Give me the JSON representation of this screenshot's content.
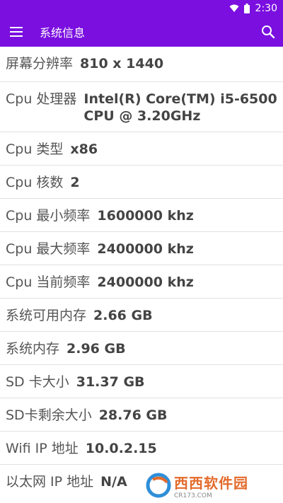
{
  "status_bar": {
    "time": "2:30",
    "icons": [
      "wifi-icon",
      "battery-icon"
    ]
  },
  "app_bar": {
    "title": "系统信息",
    "menu_icon": "menu-icon",
    "search_icon": "search-icon"
  },
  "colors": {
    "accent": "#7A0FE0",
    "divider": "#e1e1e1",
    "text": "#444444"
  },
  "rows": [
    {
      "label": "屏幕分辨率",
      "value": "810 x 1440"
    },
    {
      "label": "Cpu 处理器",
      "value": "Intel(R) Core(TM) i5-6500 CPU @ 3.20GHz"
    },
    {
      "label": "Cpu 类型",
      "value": "x86"
    },
    {
      "label": "Cpu 核数",
      "value": "2"
    },
    {
      "label": "Cpu 最小频率",
      "value": "1600000 khz"
    },
    {
      "label": "Cpu 最大频率",
      "value": "2400000 khz"
    },
    {
      "label": "Cpu 当前频率",
      "value": "2400000 khz"
    },
    {
      "label": "系统可用内存",
      "value": "2.66 GB"
    },
    {
      "label": "系统内存",
      "value": "2.96 GB"
    },
    {
      "label": "SD 卡大小",
      "value": "31.37 GB"
    },
    {
      "label": "SD卡剩余大小",
      "value": "28.76 GB"
    },
    {
      "label": "Wifi IP 地址",
      "value": "10.0.2.15"
    },
    {
      "label": "以太网 IP 地址",
      "value": "N/A"
    }
  ],
  "watermark": {
    "name": "西西软件园",
    "url": "CR173.COM"
  }
}
